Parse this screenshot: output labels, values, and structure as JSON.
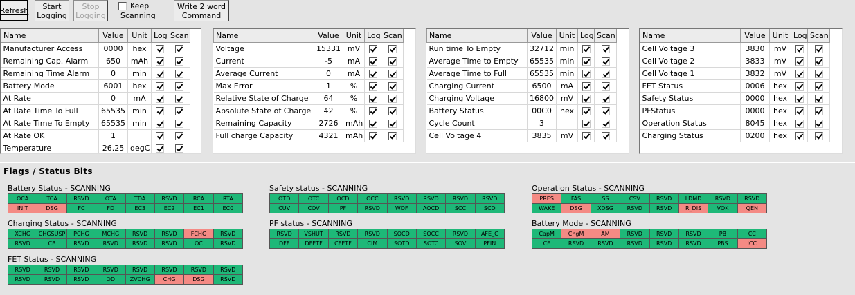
{
  "toolbar": {
    "refresh": "Refresh",
    "start_logging": "Start\nLogging",
    "stop_logging": "Stop\nLogging",
    "keep_line1": "Keep",
    "keep_line2": "Scanning",
    "keep_checked": false,
    "write_command": "Write 2 word\nCommand"
  },
  "headers": {
    "name": "Name",
    "value": "Value",
    "unit": "Unit",
    "log": "Log",
    "scan": "Scan"
  },
  "tables": [
    {
      "rows": [
        {
          "name": "Manufacturer Access",
          "value": "0000",
          "unit": "hex",
          "log": true,
          "scan": true
        },
        {
          "name": "Remaining Cap. Alarm",
          "value": "650",
          "unit": "mAh",
          "log": true,
          "scan": true
        },
        {
          "name": "Remaining Time Alarm",
          "value": "0",
          "unit": "min",
          "log": true,
          "scan": true
        },
        {
          "name": "Battery Mode",
          "value": "6001",
          "unit": "hex",
          "log": true,
          "scan": true
        },
        {
          "name": "At Rate",
          "value": "0",
          "unit": "mA",
          "log": true,
          "scan": true
        },
        {
          "name": "At Rate Time To Full",
          "value": "65535",
          "unit": "min",
          "log": true,
          "scan": true
        },
        {
          "name": "At Rate Time To Empty",
          "value": "65535",
          "unit": "min",
          "log": true,
          "scan": true
        },
        {
          "name": "At Rate OK",
          "value": "1",
          "unit": "",
          "log": true,
          "scan": true
        },
        {
          "name": "Temperature",
          "value": "26.25",
          "unit": "degC",
          "log": true,
          "scan": true
        }
      ]
    },
    {
      "rows": [
        {
          "name": "Voltage",
          "value": "15331",
          "unit": "mV",
          "log": true,
          "scan": true
        },
        {
          "name": "Current",
          "value": "-5",
          "unit": "mA",
          "log": true,
          "scan": true
        },
        {
          "name": "Average Current",
          "value": "0",
          "unit": "mA",
          "log": true,
          "scan": true
        },
        {
          "name": "Max Error",
          "value": "1",
          "unit": "%",
          "log": true,
          "scan": true
        },
        {
          "name": "Relative State of Charge",
          "value": "64",
          "unit": "%",
          "log": true,
          "scan": true
        },
        {
          "name": "Absolute State of Charge",
          "value": "42",
          "unit": "%",
          "log": true,
          "scan": true
        },
        {
          "name": "Remaining Capacity",
          "value": "2726",
          "unit": "mAh",
          "log": true,
          "scan": true
        },
        {
          "name": "Full charge Capacity",
          "value": "4321",
          "unit": "mAh",
          "log": true,
          "scan": true
        }
      ]
    },
    {
      "rows": [
        {
          "name": "Run time To Empty",
          "value": "32712",
          "unit": "min",
          "log": true,
          "scan": true
        },
        {
          "name": "Average Time to Empty",
          "value": "65535",
          "unit": "min",
          "log": true,
          "scan": true
        },
        {
          "name": "Average Time to Full",
          "value": "65535",
          "unit": "min",
          "log": true,
          "scan": true
        },
        {
          "name": "Charging Current",
          "value": "6500",
          "unit": "mA",
          "log": true,
          "scan": true
        },
        {
          "name": "Charging Voltage",
          "value": "16800",
          "unit": "mV",
          "log": true,
          "scan": true
        },
        {
          "name": "Battery Status",
          "value": "00C0",
          "unit": "hex",
          "log": true,
          "scan": true
        },
        {
          "name": "Cycle Count",
          "value": "3",
          "unit": "",
          "log": true,
          "scan": true
        },
        {
          "name": "Cell Voltage 4",
          "value": "3835",
          "unit": "mV",
          "log": true,
          "scan": true
        }
      ]
    },
    {
      "rows": [
        {
          "name": "Cell Voltage 3",
          "value": "3830",
          "unit": "mV",
          "log": true,
          "scan": true
        },
        {
          "name": "Cell Voltage 2",
          "value": "3833",
          "unit": "mV",
          "log": true,
          "scan": true
        },
        {
          "name": "Cell Voltage 1",
          "value": "3832",
          "mV": "",
          "unit": "mV",
          "log": true,
          "scan": true
        },
        {
          "name": "FET Status",
          "value": "0006",
          "unit": "hex",
          "log": true,
          "scan": true
        },
        {
          "name": "Safety Status",
          "value": "0000",
          "unit": "hex",
          "log": true,
          "scan": true
        },
        {
          "name": "PFStatus",
          "value": "0000",
          "unit": "hex",
          "log": true,
          "scan": true
        },
        {
          "name": "Operation Status",
          "value": "8045",
          "unit": "hex",
          "log": true,
          "scan": true
        },
        {
          "name": "Charging Status",
          "value": "0200",
          "unit": "hex",
          "log": true,
          "scan": true
        }
      ]
    }
  ],
  "flags_title": "Flags / Status Bits",
  "flag_colors": {
    "clear": "#1eb878",
    "set": "#f48a84"
  },
  "flag_groups": [
    {
      "title": "Battery Status - SCANNING",
      "row1": [
        "OCA",
        "TCA",
        "RSVD",
        "OTA",
        "TDA",
        "RSVD",
        "RCA",
        "RTA"
      ],
      "row1_set": [],
      "row2": [
        "INIT",
        "DSG",
        "FC",
        "FD",
        "EC3",
        "EC2",
        "EC1",
        "EC0"
      ],
      "row2_set": [
        0,
        1
      ]
    },
    {
      "title": "Safety status - SCANNING",
      "row1": [
        "OTD",
        "OTC",
        "OCD",
        "OCC",
        "RSVD",
        "RSVD",
        "RSVD",
        "RSVD"
      ],
      "row1_set": [],
      "row2": [
        "CUV",
        "COV",
        "PF",
        "RSVD",
        "WDF",
        "AOCD",
        "SCC",
        "SCD"
      ],
      "row2_set": []
    },
    {
      "title": "Operation Status - SCANNING",
      "row1": [
        "PRES",
        "FAS",
        "SS",
        "CSV",
        "RSVD",
        "LDMD",
        "RSVD",
        "RSVD"
      ],
      "row1_set": [
        0
      ],
      "row2": [
        "WAKE",
        "DSG",
        "XDSG",
        "RSVD",
        "RSVD",
        "R_DIS",
        "VOK",
        "QEN"
      ],
      "row2_set": [
        1,
        5,
        7
      ]
    },
    {
      "title": "Charging Status - SCANNING",
      "row1": [
        "XCHG",
        "CHGSUSP",
        "PCHG",
        "MCHG",
        "RSVD",
        "RSVD",
        "FCHG",
        "RSVD"
      ],
      "row1_set": [
        6
      ],
      "row2": [
        "RSVD",
        "CB",
        "RSVD",
        "RSVD",
        "RSVD",
        "RSVD",
        "OC",
        "RSVD"
      ],
      "row2_set": []
    },
    {
      "title": "PF status - SCANNING",
      "row1": [
        "RSVD",
        "VSHUT",
        "RSVD",
        "RSVD",
        "SOCD",
        "SOCC",
        "RSVD",
        "AFE_C"
      ],
      "row1_set": [],
      "row2": [
        "DFF",
        "DFETF",
        "CFETF",
        "CIM",
        "SOTD",
        "SOTC",
        "SOV",
        "PFIN"
      ],
      "row2_set": []
    },
    {
      "title": "Battery Mode - SCANNING",
      "row1": [
        "CapM",
        "ChgM",
        "AM",
        "RSVD",
        "RSVD",
        "RSVD",
        "PB",
        "CC"
      ],
      "row1_set": [
        1,
        2
      ],
      "row2": [
        "CF",
        "RSVD",
        "RSVD",
        "RSVD",
        "RSVD",
        "RSVD",
        "PBS",
        "ICC"
      ],
      "row2_set": [
        7
      ]
    },
    {
      "title": "FET Status - SCANNING",
      "row1": [
        "RSVD",
        "RSVD",
        "RSVD",
        "RSVD",
        "RSVD",
        "RSVD",
        "RSVD",
        "RSVD"
      ],
      "row1_set": [],
      "row2": [
        "RSVD",
        "RSVD",
        "RSVD",
        "OD",
        "ZVCHG",
        "CHG",
        "DSG",
        "RSVD"
      ],
      "row2_set": [
        5,
        6
      ]
    }
  ]
}
